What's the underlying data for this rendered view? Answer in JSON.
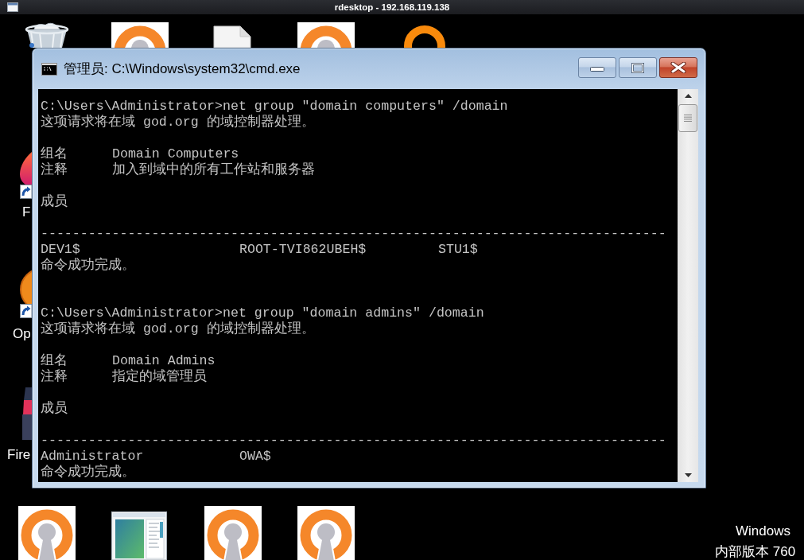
{
  "remote_session": {
    "title": "rdesktop - 192.168.119.138"
  },
  "desktop": {
    "shortcut_labels": [
      "F",
      "Op",
      "Fire"
    ],
    "build_notice": [
      "Windows",
      "内部版本 760"
    ]
  },
  "console_window": {
    "title": "管理员: C:\\Windows\\system32\\cmd.exe",
    "sessions": [
      {
        "command_line": "C:\\Users\\Administrator>net group \"domain computers\" /domain",
        "notice": "这项请求将在域 god.org 的域控制器处理。",
        "properties": [
          {
            "label": "组名",
            "value": "Domain Computers"
          },
          {
            "label": "注释",
            "value": "加入到域中的所有工作站和服务器"
          }
        ],
        "members_heading": "成员",
        "separator": "-------------------------------------------------------------------------------",
        "members": [
          "DEV1$",
          "ROOT-TVI862UBEH$",
          "STU1$"
        ],
        "status": "命令成功完成。"
      },
      {
        "command_line": "C:\\Users\\Administrator>net group \"domain admins\" /domain",
        "notice": "这项请求将在域 god.org 的域控制器处理。",
        "properties": [
          {
            "label": "组名",
            "value": "Domain Admins"
          },
          {
            "label": "注释",
            "value": "指定的域管理员"
          }
        ],
        "members_heading": "成员",
        "separator": "-------------------------------------------------------------------------------",
        "members": [
          "Administrator",
          "OWA$"
        ],
        "status": "命令成功完成。"
      }
    ]
  }
}
